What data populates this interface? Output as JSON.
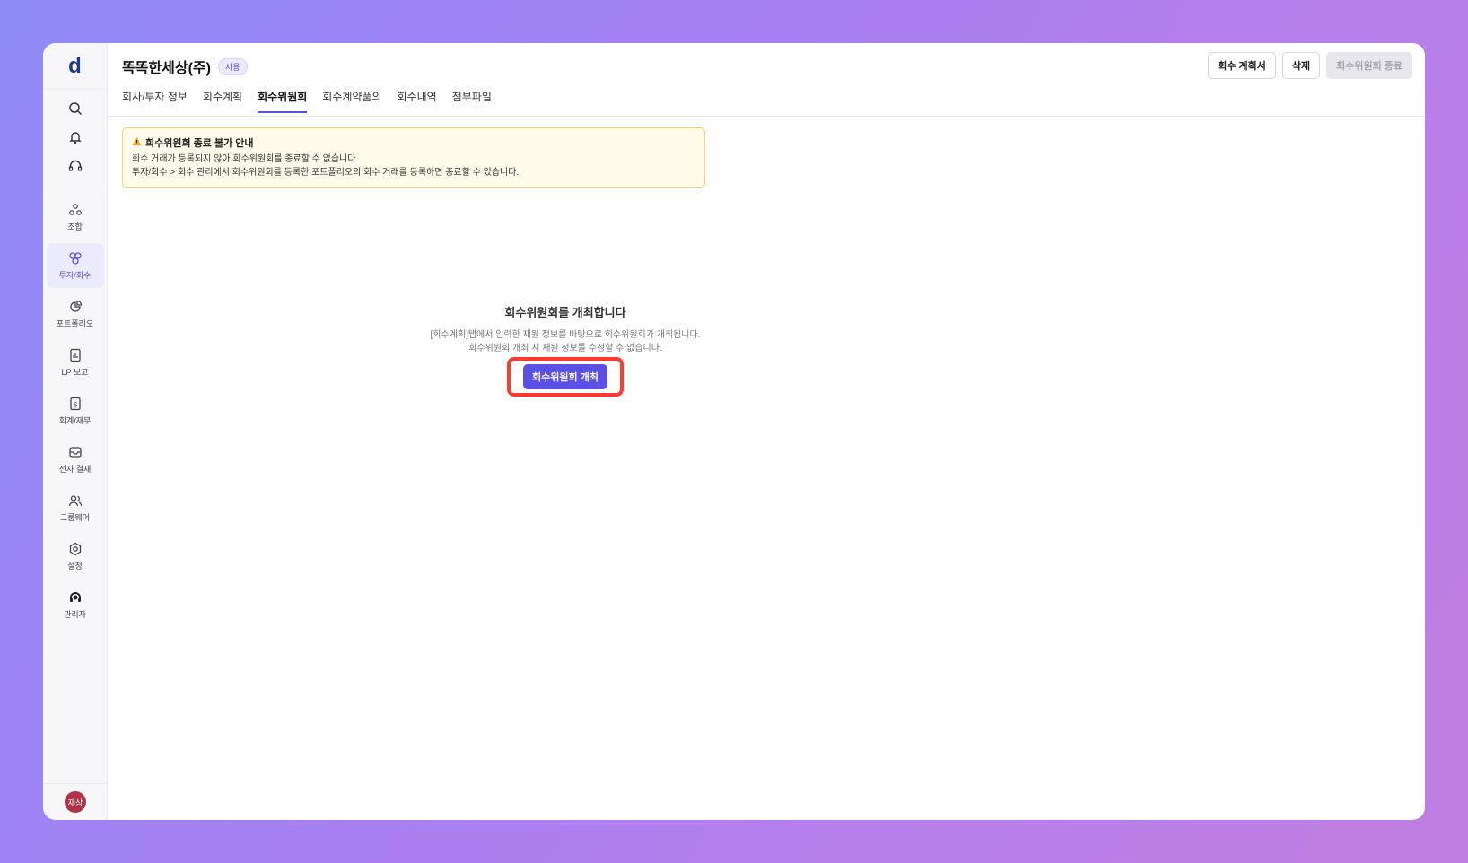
{
  "sidebar": {
    "logo": "d",
    "tools": [
      "search-icon",
      "bell-icon",
      "headset-icon"
    ],
    "items": [
      {
        "label": "조합",
        "icon": "union-icon"
      },
      {
        "label": "투자/회수",
        "icon": "investment-icon",
        "active": true
      },
      {
        "label": "포트폴리오",
        "icon": "pie-chart-icon"
      },
      {
        "label": "LP 보고",
        "icon": "report-icon"
      },
      {
        "label": "회계/재무",
        "icon": "accounting-icon"
      },
      {
        "label": "전자 결재",
        "icon": "inbox-icon"
      },
      {
        "label": "그룹웨어",
        "icon": "users-icon"
      },
      {
        "label": "설정",
        "icon": "gear-icon"
      },
      {
        "label": "관리자",
        "icon": "admin-icon"
      }
    ],
    "avatar": "재상"
  },
  "header": {
    "company": "똑똑한세상(주)",
    "badge": "사용",
    "tabs": [
      {
        "label": "회사/투자 정보"
      },
      {
        "label": "회수계획"
      },
      {
        "label": "회수위원회",
        "active": true
      },
      {
        "label": "회수계약품의"
      },
      {
        "label": "회수내역"
      },
      {
        "label": "첨부파일"
      }
    ],
    "actions": {
      "plan": "회수 계획서",
      "delete": "삭제",
      "end": "회수위원회 종료"
    }
  },
  "notice": {
    "title": "회수위원회 종료 불가 안내",
    "line1": "회수 거래가 등록되지 않아 회수위원회를 종료할 수 없습니다.",
    "line2": "투자/회수 > 회수 관리에서 회수위원회를 등록한 포트폴리오의 회수 거래를 등록하면 종료할 수 있습니다."
  },
  "empty_state": {
    "title": "회수위원회를 개최합니다",
    "desc1": "[회수계획]탭에서 입력한 재원 정보를 바탕으로 회수위원회가 개최됩니다.",
    "desc2": "회수위원회 개최 시 재원 정보를 수정할 수 없습니다.",
    "button": "회수위원회 개최"
  },
  "colors": {
    "accent": "#5b50e6",
    "highlight": "#ff3b30",
    "notice_bg": "#fffbea"
  }
}
